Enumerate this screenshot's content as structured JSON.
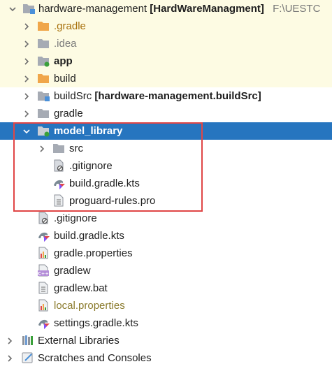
{
  "tree": {
    "root": {
      "name": "hardware-management",
      "module": "[HardWareManagment]",
      "path": "F:\\UESTC"
    },
    "gradle_dir": ".gradle",
    "idea_dir": ".idea",
    "app": "app",
    "build": "build",
    "buildsrc": {
      "name": "buildSrc",
      "module": "[hardware-management.buildSrc]"
    },
    "gradle": "gradle",
    "model_library": {
      "name": "model_library",
      "children": {
        "src": "src",
        "gitignore": ".gitignore",
        "build_gradle": "build.gradle.kts",
        "proguard": "proguard-rules.pro"
      }
    },
    "gitignore": ".gitignore",
    "build_gradle": "build.gradle.kts",
    "gradle_properties": "gradle.properties",
    "gradlew": "gradlew",
    "gradlew_bat": "gradlew.bat",
    "local_properties": "local.properties",
    "settings_gradle": "settings.gradle.kts",
    "external_libraries": "External Libraries",
    "scratches": "Scratches and Consoles"
  },
  "icons": {
    "module_folder": "module-folder-icon",
    "excluded_folder": "excluded-folder-icon",
    "folder": "folder-icon",
    "gradle_file": "gradle-kts-icon",
    "text_file": "text-file-icon",
    "ignore_file": "ignore-file-icon",
    "properties_file": "properties-icon",
    "cpp_file": "cpp-file-icon",
    "library": "library-icon",
    "scratch": "scratch-icon"
  },
  "colors": {
    "selection": "#2675bf",
    "highlight_box": "#e04646",
    "excluded_folder": "#f0a64a",
    "folder": "#a6abb4",
    "module_badge": "#3aa03a"
  }
}
